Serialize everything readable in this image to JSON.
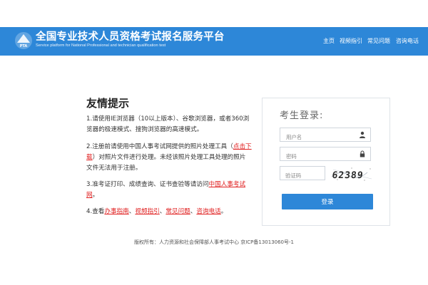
{
  "header": {
    "title": "全国专业技术人员资格考试报名服务平台",
    "subtitle": "Service platform for National Professional and technician qualification test",
    "logo_text": "PTA",
    "nav": [
      "主页",
      "视频指引",
      "常见问题",
      "咨询电话"
    ]
  },
  "notice": {
    "title": "友情提示",
    "item1": "1.请使用IE浏览器（10以上版本）、谷歌浏览器，或者360浏览器的极速模式、搜狗浏览器的高速模式。",
    "item2_a": "2.注册前请使用中国人事考试网提供的照片处理工具（",
    "item2_link": "点击下载",
    "item2_b": "）对照片文件进行处理。未经该照片处理工具处理的照片文件无法用于注册。",
    "item3_a": "3.准考证打印、成绩查询、证书查验等请访问",
    "item3_link": "中国人事考试网",
    "item3_b": "。",
    "item4_a": "4.查看",
    "item4_links": [
      "办事指南",
      "视频指引",
      "常见问题",
      "咨询电话"
    ],
    "item4_sep": "、",
    "item4_end": "。"
  },
  "login": {
    "title": "考生登录:",
    "username_placeholder": "用户名",
    "password_placeholder": "密码",
    "captcha_placeholder": "验证码",
    "captcha_text": "62389",
    "button_label": "登录"
  },
  "footer": {
    "text": "版权所有：人力资源和社会保障部人事考试中心 京ICP备13013060号-1"
  },
  "colors": {
    "header_bg": "#2d87d8",
    "button_bg": "#2d87d8",
    "link_red": "#e02020"
  }
}
